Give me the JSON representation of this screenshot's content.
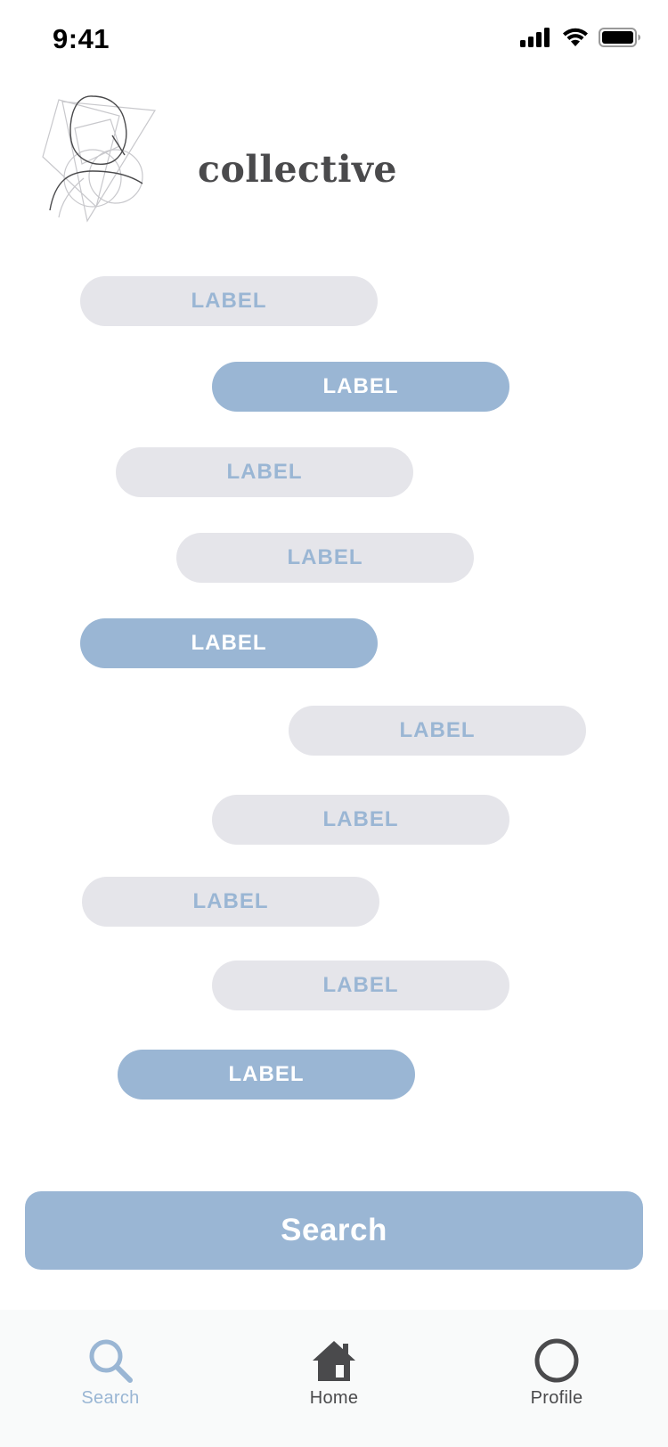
{
  "status_bar": {
    "time": "9:41"
  },
  "brand": {
    "title": "collective"
  },
  "tags": [
    {
      "label": "LABEL",
      "selected": false
    },
    {
      "label": "LABEL",
      "selected": true
    },
    {
      "label": "LABEL",
      "selected": false
    },
    {
      "label": "LABEL",
      "selected": false
    },
    {
      "label": "LABEL",
      "selected": true
    },
    {
      "label": "LABEL",
      "selected": false
    },
    {
      "label": "LABEL",
      "selected": false
    },
    {
      "label": "LABEL",
      "selected": false
    },
    {
      "label": "LABEL",
      "selected": false
    },
    {
      "label": "LABEL",
      "selected": true
    }
  ],
  "search_button": {
    "label": "Search"
  },
  "tab_bar": {
    "tabs": [
      {
        "label": "Search",
        "icon": "search-icon",
        "active": true
      },
      {
        "label": "Home",
        "icon": "home-icon",
        "active": false
      },
      {
        "label": "Profile",
        "icon": "profile-icon",
        "active": false
      }
    ]
  },
  "colors": {
    "accent": "#9ab6d4",
    "pill_inactive": "#e5e5ea",
    "title_text": "#4a4a4c",
    "tab_bar_bg": "#f9fafa"
  }
}
